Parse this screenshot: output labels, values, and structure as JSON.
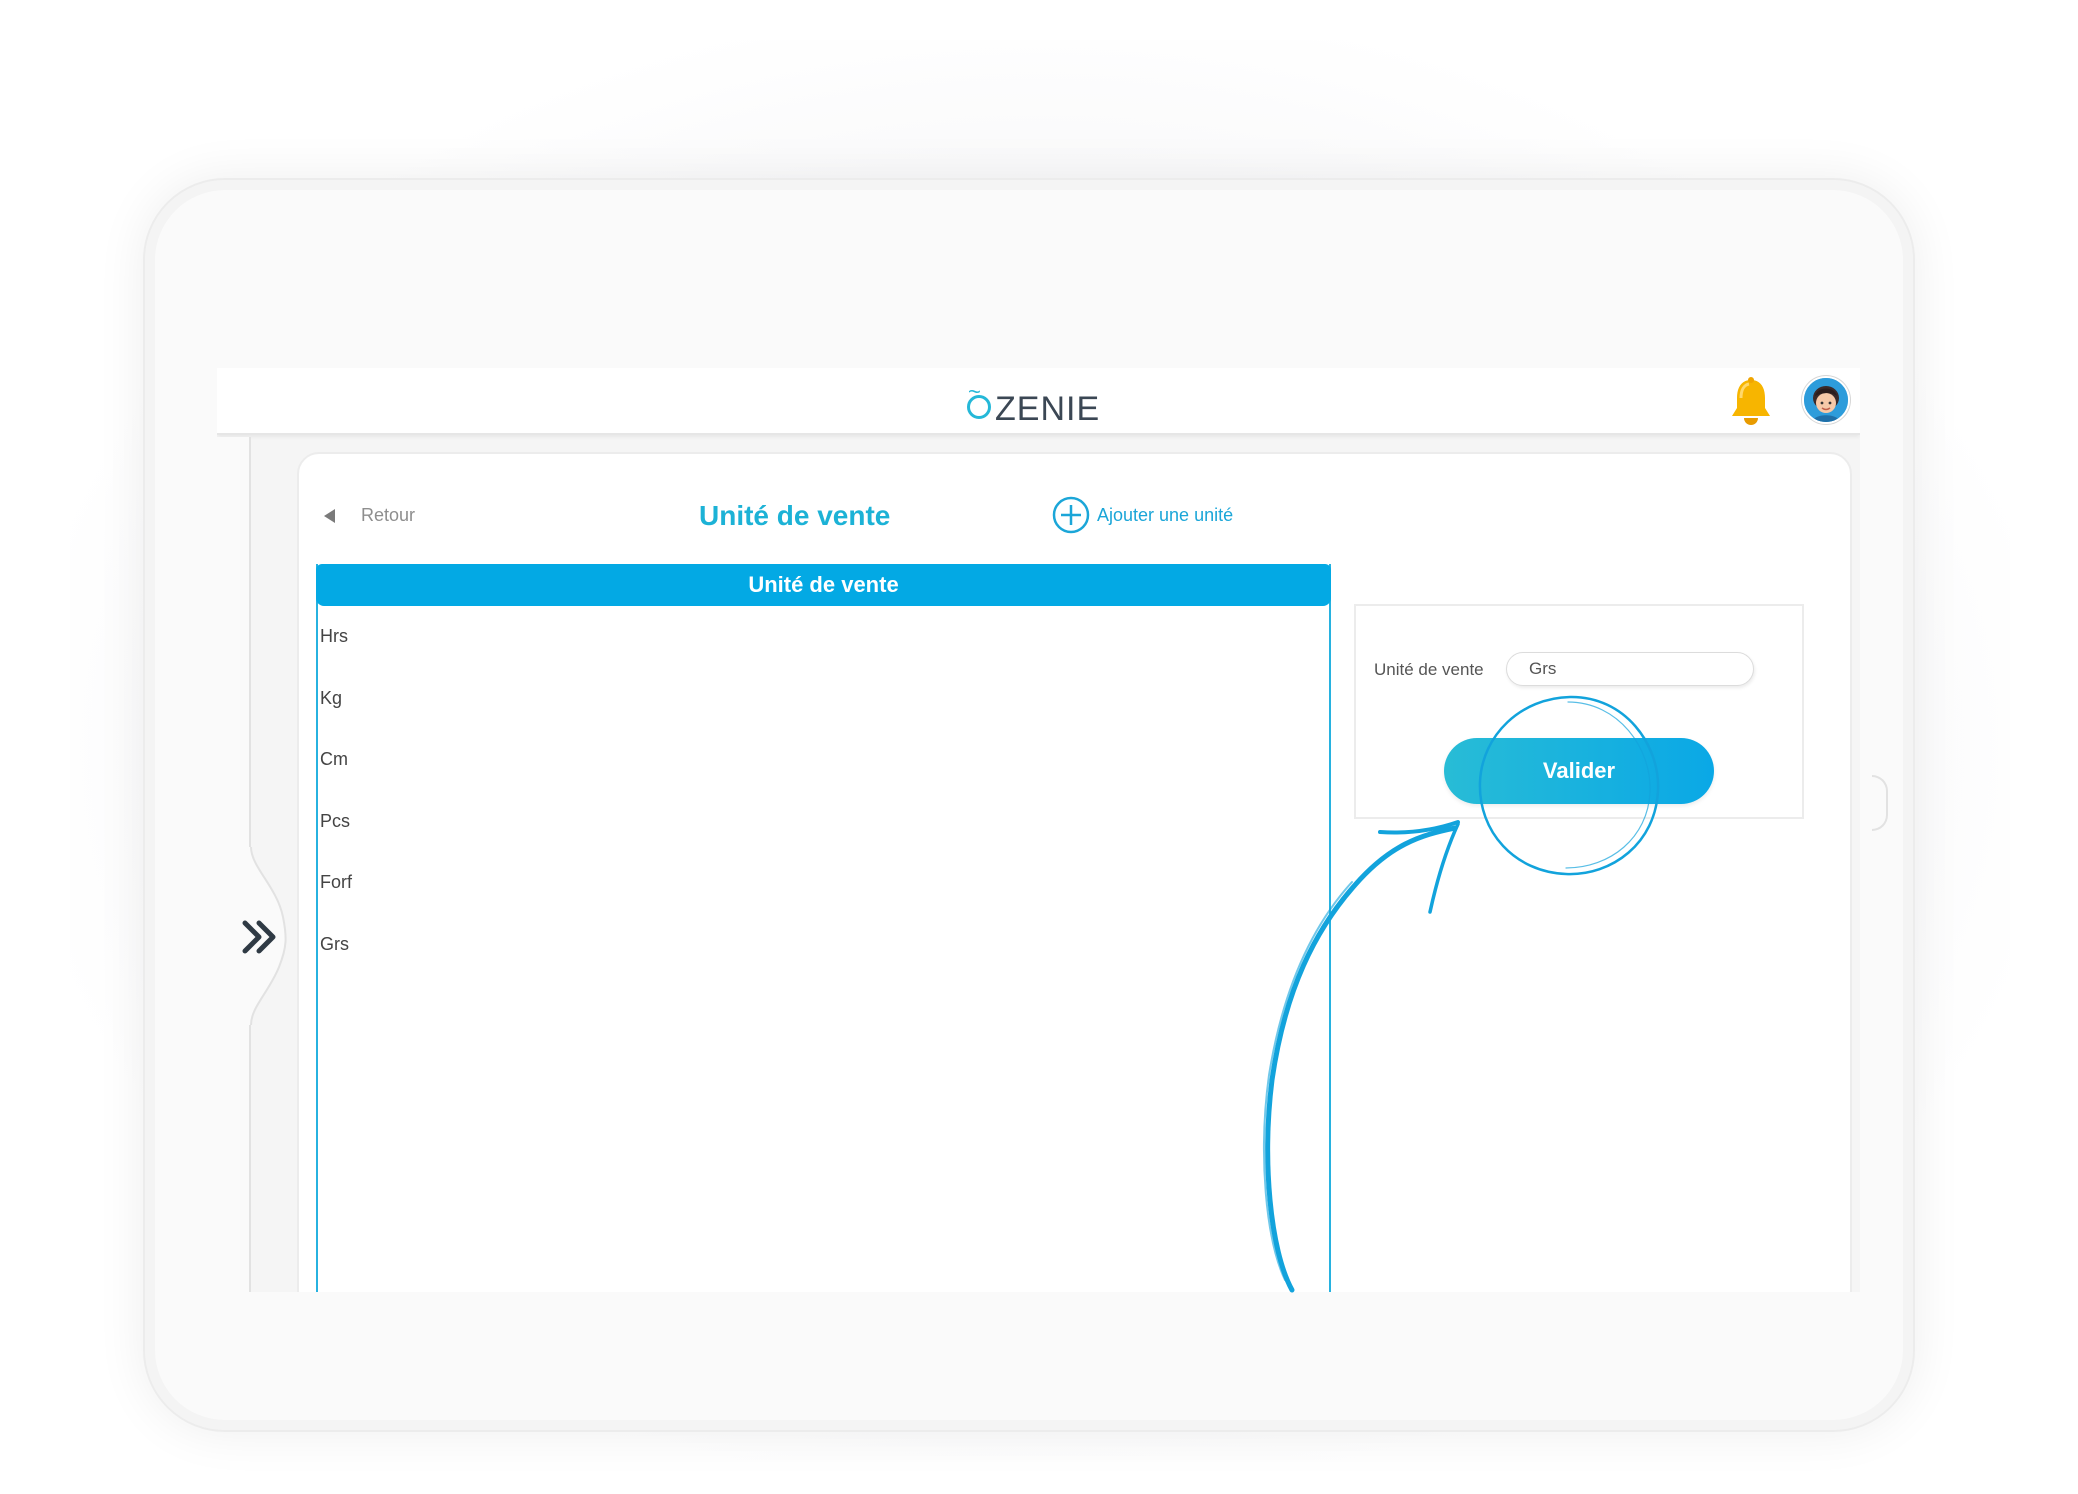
{
  "app": {
    "logo_text": "ZENIE",
    "logo_mark": "Õ"
  },
  "nav": {
    "back_label": "Retour",
    "page_title": "Unité de vente",
    "add_label": "Ajouter une unité",
    "sidebar_expand_glyph": "»"
  },
  "list": {
    "header": "Unité de vente",
    "items": [
      "Hrs",
      "Kg",
      "Cm",
      "Pcs",
      "Forf",
      "Grs"
    ]
  },
  "form": {
    "label": "Unité de vente",
    "value": "Grs",
    "submit_label": "Valider"
  },
  "colors": {
    "accent": "#1cb2d6",
    "header_bg": "#03a9e4",
    "bell": "#f7b500",
    "annotation": "#12a3dc"
  },
  "icons": {
    "notification": "bell-icon",
    "profile": "avatar",
    "add": "plus-circle-icon",
    "back": "triangle-left-icon",
    "sidebar": "double-chevron-right-icon"
  }
}
